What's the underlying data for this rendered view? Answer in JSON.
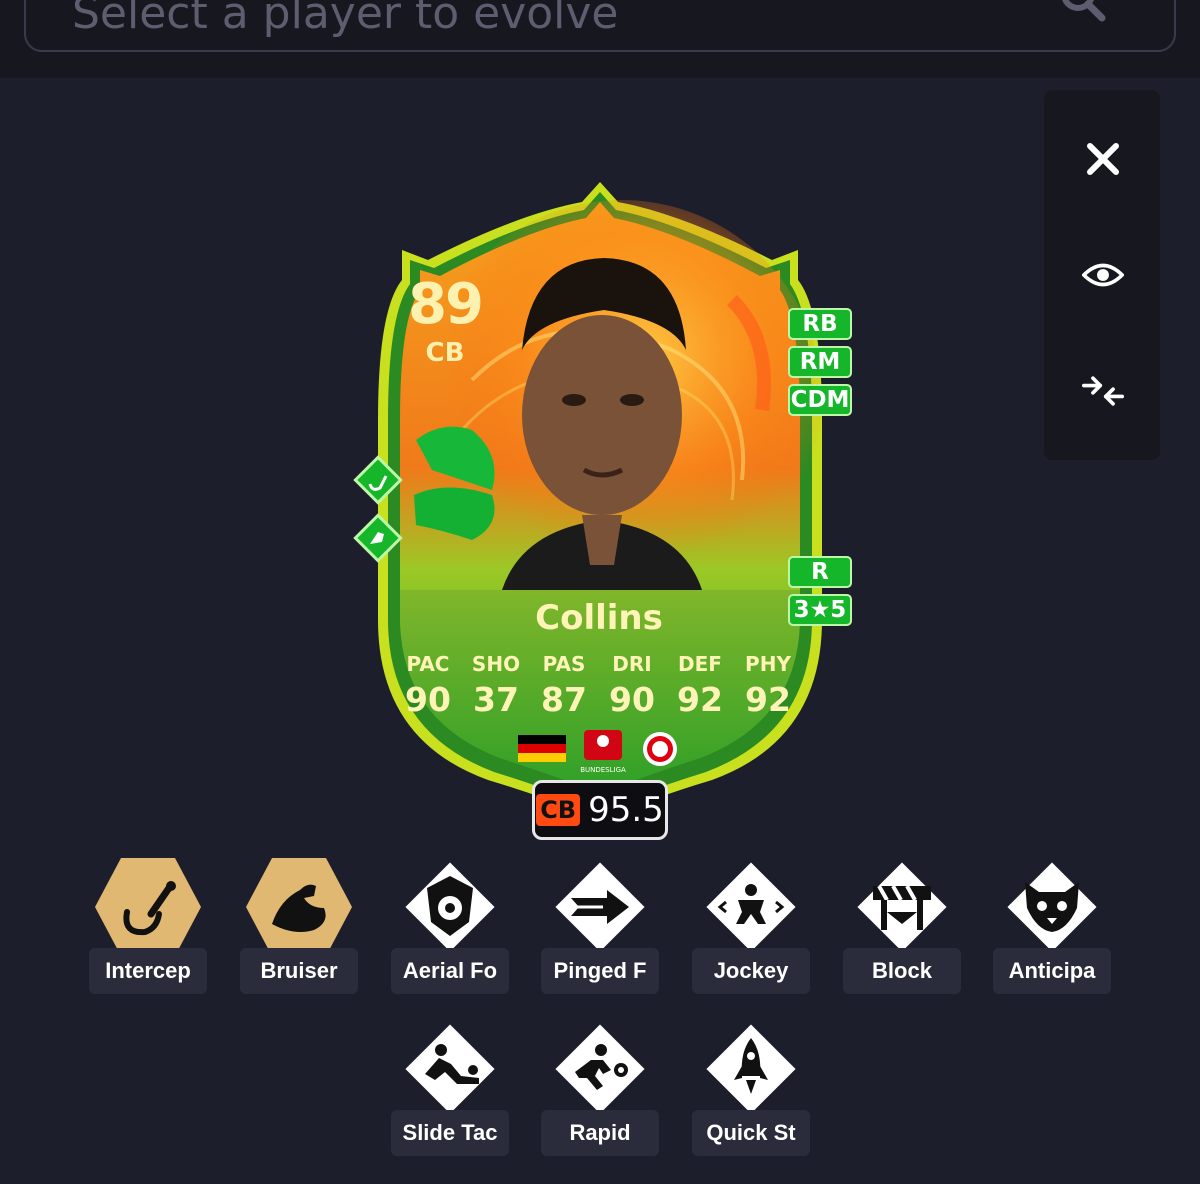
{
  "search": {
    "placeholder": "Select a player to evolve"
  },
  "side_panel": {
    "buttons": [
      "close",
      "view",
      "compare"
    ]
  },
  "card": {
    "rating": "89",
    "position": "CB",
    "alt_positions": [
      "RB",
      "RM",
      "CDM"
    ],
    "foot": "R",
    "skill_weak": "3★5",
    "name": "Collins",
    "stats": [
      {
        "label": "PAC",
        "value": "90"
      },
      {
        "label": "SHO",
        "value": "37"
      },
      {
        "label": "PAS",
        "value": "87"
      },
      {
        "label": "DRI",
        "value": "90"
      },
      {
        "label": "DEF",
        "value": "92"
      },
      {
        "label": "PHY",
        "value": "92"
      }
    ],
    "league_label": "BUNDESLIGA",
    "colors": {
      "card_orange": "#f59a1c",
      "card_green": "#2fae2c",
      "accent_green": "#16b62a"
    }
  },
  "rating_box": {
    "position": "CB",
    "value": "95.5"
  },
  "playstyles": [
    {
      "label": "Intercep",
      "icon": "intercept-icon",
      "plus": true
    },
    {
      "label": "Bruiser",
      "icon": "bruiser-icon",
      "plus": true
    },
    {
      "label": "Aerial Fo",
      "icon": "aerial-fortress-icon",
      "plus": false
    },
    {
      "label": "Pinged F",
      "icon": "pinged-pass-icon",
      "plus": false
    },
    {
      "label": "Jockey",
      "icon": "jockey-icon",
      "plus": false
    },
    {
      "label": "Block",
      "icon": "block-icon",
      "plus": false
    },
    {
      "label": "Anticipa",
      "icon": "anticipate-icon",
      "plus": false
    },
    {
      "label": "Slide Tac",
      "icon": "slide-tackle-icon",
      "plus": false
    },
    {
      "label": "Rapid",
      "icon": "rapid-icon",
      "plus": false
    },
    {
      "label": "Quick St",
      "icon": "quick-step-icon",
      "plus": false
    }
  ],
  "colors": {
    "background": "#1d1e2c",
    "panel": "#17171f",
    "gold": "#e0b872"
  }
}
